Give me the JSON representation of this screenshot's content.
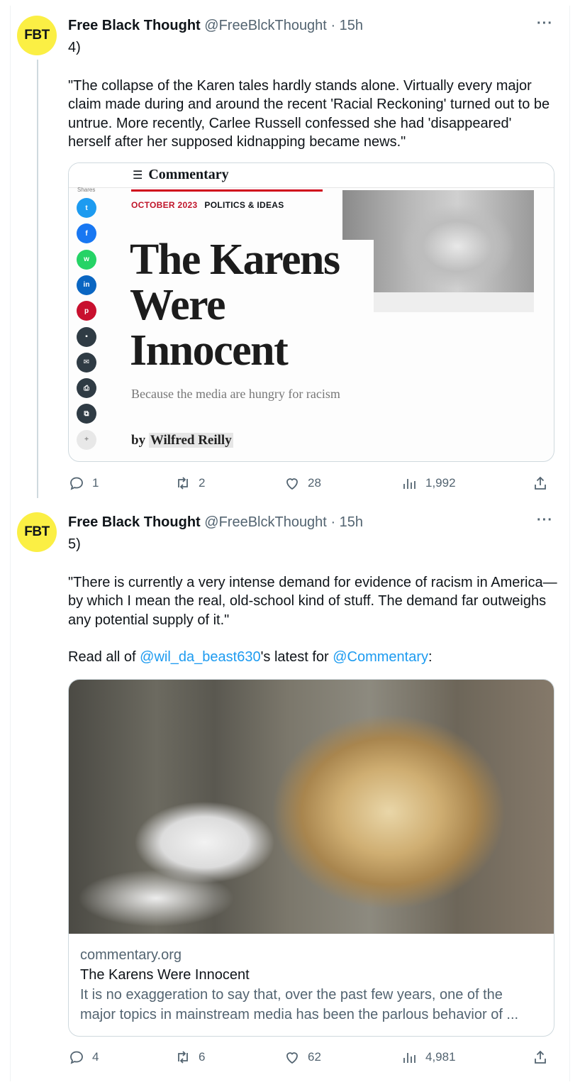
{
  "tweets": [
    {
      "avatar": "FBT",
      "name": "Free Black Thought",
      "handle": "@FreeBlckThought",
      "time": "· 15h",
      "more": "···",
      "number": "4)",
      "quote": "\"The collapse of the Karen tales hardly stands alone. Virtually every major claim made during and around the recent 'Racial Reckoning' turned out to be untrue. More recently, Carlee Russell confessed she had 'disappeared' herself after her supposed kidnapping became news.\"",
      "actions": {
        "replies": "1",
        "retweets": "2",
        "likes": "28",
        "views": "1,992"
      }
    },
    {
      "avatar": "FBT",
      "name": "Free Black Thought",
      "handle": "@FreeBlckThought",
      "time": "· 15h",
      "more": "···",
      "number": "5)",
      "quote": "\"There is currently a very intense demand for evidence of racism in America—by which I mean the real, old-school kind of stuff. The demand far outweighs any potential supply of it.\"",
      "read_prefix": "Read all of ",
      "mention1": "@wil_da_beast630",
      "read_middle": "'s latest for ",
      "mention2": "@Commentary",
      "read_suffix": ":",
      "actions": {
        "replies": "4",
        "retweets": "6",
        "likes": "62",
        "views": "4,981"
      }
    }
  ],
  "article_card": {
    "menu_icon": "☰",
    "brand": "Commentary",
    "shares_label": "Shares",
    "kicker_date": "OCTOBER 2023",
    "kicker_section": "POLITICS & IDEAS",
    "headline": "The Karens Were Innocent",
    "subhead": "Because the media are hungry for racism",
    "by": "by",
    "author": "Wilfred Reilly",
    "share_buttons": [
      {
        "icon": "twitter-icon",
        "glyph": "t",
        "color": "#1d9bf0"
      },
      {
        "icon": "facebook-icon",
        "glyph": "f",
        "color": "#1877f2"
      },
      {
        "icon": "whatsapp-icon",
        "glyph": "w",
        "color": "#25d366"
      },
      {
        "icon": "linkedin-icon",
        "glyph": "in",
        "color": "#0a66c2"
      },
      {
        "icon": "pinterest-icon",
        "glyph": "p",
        "color": "#c8102e"
      },
      {
        "icon": "sms-icon",
        "glyph": "▪",
        "color": "#2f3b44"
      },
      {
        "icon": "email-icon",
        "glyph": "✉",
        "color": "#2f3b44"
      },
      {
        "icon": "print-icon",
        "glyph": "⎙",
        "color": "#2f3b44"
      },
      {
        "icon": "copy-icon",
        "glyph": "⧉",
        "color": "#2f3b44"
      },
      {
        "icon": "more-icon",
        "glyph": "+",
        "color": "#e8e8e8"
      }
    ]
  },
  "link_card": {
    "domain": "commentary.org",
    "title": "The Karens Were Innocent",
    "description": "It is no exaggeration to say that, over the past few years, one of the major topics in mainstream media has been the parlous behavior of ..."
  }
}
